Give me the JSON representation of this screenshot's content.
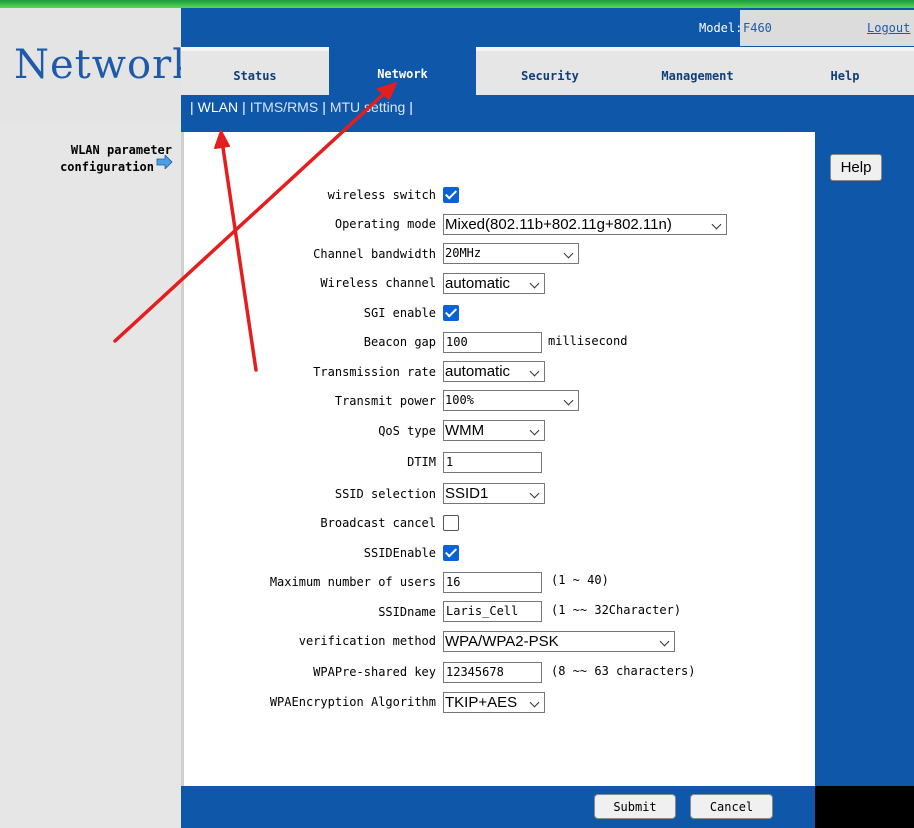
{
  "header": {
    "brand": "Network",
    "model_label": "Model:",
    "model_value": "F460",
    "logout": "Logout"
  },
  "tabs": [
    {
      "label": "Status",
      "active": false
    },
    {
      "label": "Network",
      "active": true
    },
    {
      "label": "Security",
      "active": false
    },
    {
      "label": "Management",
      "active": false
    },
    {
      "label": "Help",
      "active": false
    }
  ],
  "subnav": {
    "items": [
      "WLAN",
      "ITMS/RMS",
      "MTU setting"
    ],
    "separator": "|"
  },
  "sidebar": {
    "line1": "WLAN parameter",
    "line2": "configuration"
  },
  "help_button": "Help",
  "form": {
    "wireless_switch": {
      "label": "wireless switch",
      "checked": true
    },
    "operating_mode": {
      "label": "Operating mode",
      "value": "Mixed(802.11b+802.11g+802.11n)"
    },
    "channel_bandwidth": {
      "label": "Channel bandwidth",
      "value": "20MHz"
    },
    "wireless_channel": {
      "label": "Wireless channel",
      "value": "automatic"
    },
    "sgi_enable": {
      "label": "SGI enable",
      "checked": true
    },
    "beacon_gap": {
      "label": "Beacon gap",
      "value": "100",
      "unit": "millisecond"
    },
    "transmission_rate": {
      "label": "Transmission rate",
      "value": "automatic"
    },
    "transmit_power": {
      "label": "Transmit power",
      "value": "100%"
    },
    "qos_type": {
      "label": "QoS type",
      "value": "WMM"
    },
    "dtim": {
      "label": "DTIM",
      "value": "1"
    },
    "ssid_selection": {
      "label": "SSID selection",
      "value": "SSID1"
    },
    "broadcast_cancel": {
      "label": "Broadcast cancel",
      "checked": false
    },
    "ssid_enable": {
      "label": "SSIDEnable",
      "checked": true
    },
    "max_users": {
      "label": "Maximum number of users",
      "value": "16",
      "hint": "(1 ~ 40)"
    },
    "ssid_name": {
      "label": "SSIDname",
      "value": "Laris_Cell",
      "hint": "(1 ~~ 32Character)"
    },
    "verification_method": {
      "label": "verification method",
      "value": "WPA/WPA2-PSK"
    },
    "wpa_psk": {
      "label": "WPAPre-shared key",
      "value": "12345678",
      "hint": "(8 ~~ 63 characters)"
    },
    "wpa_encryption": {
      "label": "WPAEncryption Algorithm",
      "value": "TKIP+AES"
    }
  },
  "footer": {
    "submit": "Submit",
    "cancel": "Cancel"
  },
  "colors": {
    "brand_blue": "#0f57a8",
    "title_blue": "#1e5aa8",
    "annotation_red": "#e41e1e",
    "checkbox_blue": "#0a63d6"
  }
}
